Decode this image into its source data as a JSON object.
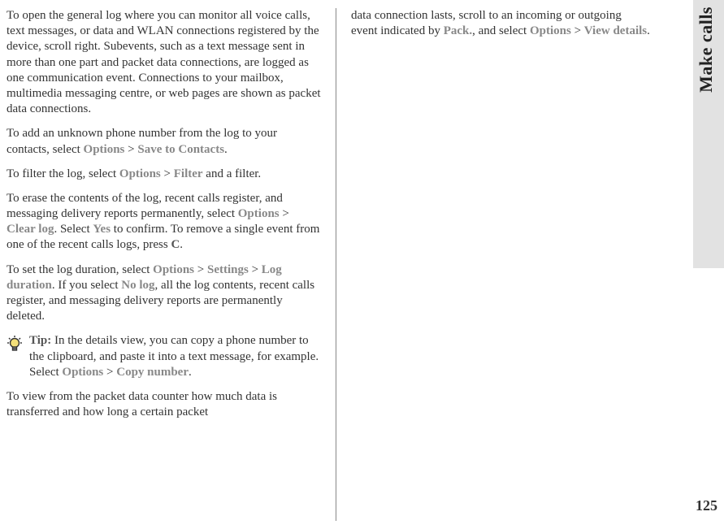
{
  "sideTab": "Make calls",
  "pageNumber": "125",
  "col1": {
    "p1a": "To open the general log where you can monitor all voice calls, text messages, or data and WLAN connections registered by the device, scroll right. Subevents, such as a text message sent in more than one part and packet data connections, are logged as one communication event. Connections to your mailbox, multimedia messaging centre, or web pages are shown as packet data connections.",
    "p2a": "To add an unknown phone number from the log to your contacts, select ",
    "p2m1": "Options",
    "p2sep": " > ",
    "p2m2": "Save to Contacts",
    "p2end": ".",
    "p3a": "To filter the log, select ",
    "p3m1": "Options",
    "p3sep": " > ",
    "p3m2": "Filter",
    "p3end": " and a filter.",
    "p4a": "To erase the contents of the log, recent calls register, and messaging delivery reports permanently, select ",
    "p4m1": "Options",
    "p4sep": " > ",
    "p4m2": "Clear log",
    "p4mid": ". Select ",
    "p4m3": "Yes",
    "p4b": " to confirm. To remove a single event from one of the recent calls logs, press ",
    "p4c": "C",
    "p4end": ".",
    "p5a": "To set the log duration, select ",
    "p5m1": "Options",
    "p5sep1": " > ",
    "p5m2": "Settings",
    "p5sep2": " > ",
    "p5m3": "Log duration",
    "p5mid": ". If you select ",
    "p5m4": "No log",
    "p5b": ", all the log contents, recent calls register, and messaging delivery reports are permanently deleted.",
    "tipLabel": "Tip: ",
    "tipA": "In the details view, you can copy a phone number to the clipboard, and paste it into a text message, for example. Select ",
    "tipM1": "Options",
    "tipSep": " > ",
    "tipM2": "Copy number",
    "tipEnd": ".",
    "p6": "To view from the packet data counter how much data is transferred and how long a certain packet"
  },
  "col2": {
    "p1a": "data connection lasts, scroll to an incoming or outgoing event indicated by ",
    "p1m1": "Pack.",
    "p1mid": ", and select ",
    "p1m2": "Options",
    "p1sep": " > ",
    "p1m3": "View details",
    "p1end": "."
  }
}
